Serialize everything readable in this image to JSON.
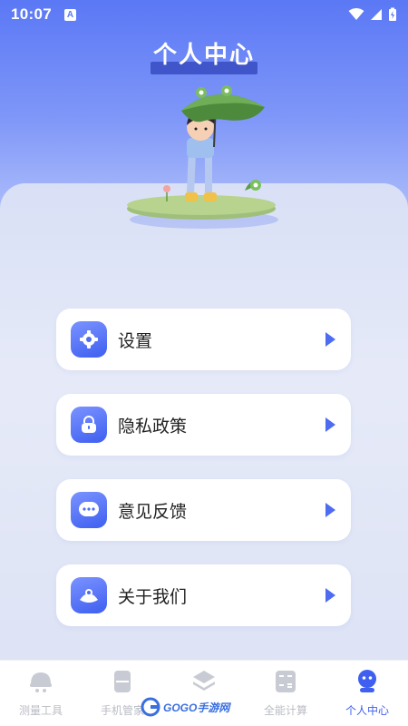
{
  "status_bar": {
    "time": "10:07",
    "notice_glyph": "A"
  },
  "header": {
    "title": "个人中心"
  },
  "menu": [
    {
      "label": "设置",
      "icon": "gear-icon"
    },
    {
      "label": "隐私政策",
      "icon": "lock-icon"
    },
    {
      "label": "意见反馈",
      "icon": "chat-bubble-icon"
    },
    {
      "label": "关于我们",
      "icon": "info-person-icon"
    }
  ],
  "tabbar": [
    {
      "label": "测量工具",
      "icon": "helmet-icon",
      "active": false
    },
    {
      "label": "手机管家",
      "icon": "phone-icon",
      "active": false
    },
    {
      "label": "",
      "icon": "layers-icon",
      "active": false
    },
    {
      "label": "全能计算",
      "icon": "calculator-icon",
      "active": false
    },
    {
      "label": "个人中心",
      "icon": "user-icon",
      "active": true
    }
  ],
  "watermark": {
    "text": "GOGO手游网"
  },
  "colors": {
    "accent": "#3e5ff0",
    "header_top": "#5b78f5",
    "inactive": "#b9bcc4"
  }
}
